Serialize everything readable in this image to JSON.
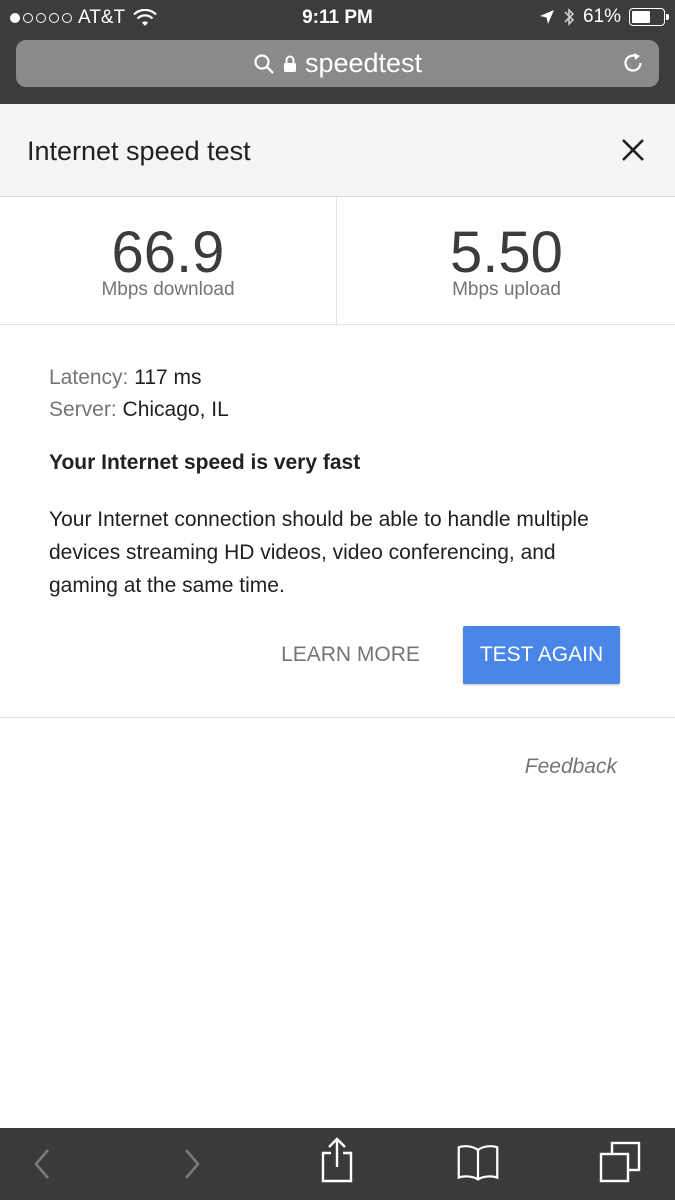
{
  "status_bar": {
    "carrier": "AT&T",
    "signal_bars_filled": 1,
    "signal_bars_total": 5,
    "time": "9:11 PM",
    "battery_percent": "61%",
    "battery_level": 0.61
  },
  "browser": {
    "url_text": "speedtest"
  },
  "card": {
    "title": "Internet speed test"
  },
  "results": {
    "download_value": "66.9",
    "download_unit": "Mbps download",
    "upload_value": "5.50",
    "upload_unit": "Mbps upload"
  },
  "details": {
    "latency_label": "Latency:",
    "latency_value": "117 ms",
    "server_label": "Server:",
    "server_value": "Chicago, IL"
  },
  "summary": {
    "heading": "Your Internet speed is very fast",
    "description": "Your Internet connection should be able to handle multiple devices streaming HD videos, video conferencing, and gaming at the same time."
  },
  "actions": {
    "learn_more_label": "LEARN MORE",
    "test_again_label": "TEST AGAIN",
    "feedback_label": "Feedback"
  },
  "colors": {
    "accent": "#4a86e8",
    "chrome": "#3c3c3c"
  }
}
